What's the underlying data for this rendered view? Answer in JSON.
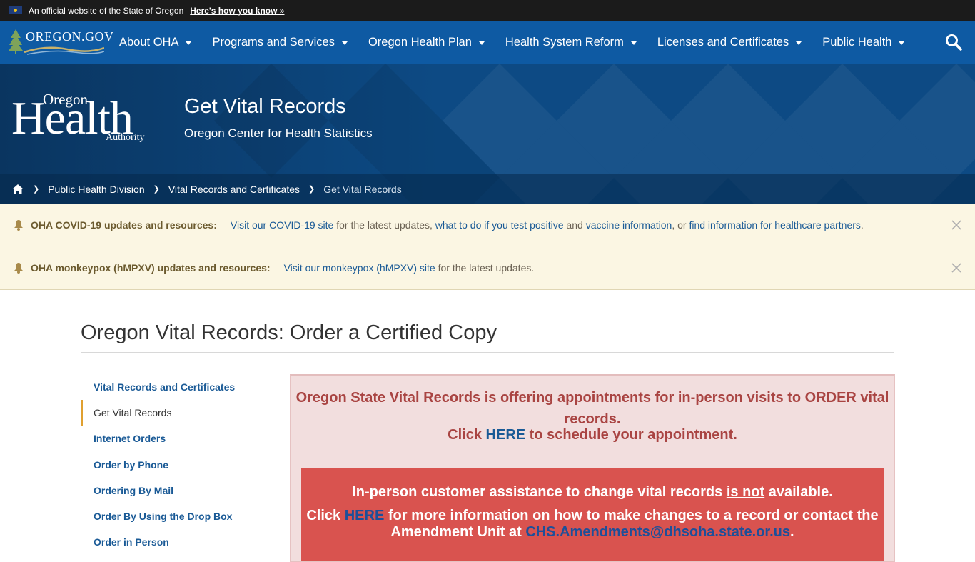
{
  "govbar": {
    "official_text": "An official website of the State of Oregon",
    "how_text": "Here's how you know »"
  },
  "nav": {
    "logo_text": "OREGON.GOV",
    "items": [
      {
        "label": "About OHA"
      },
      {
        "label": "Programs and Services"
      },
      {
        "label": "Oregon Health Plan"
      },
      {
        "label": "Health System Reform"
      },
      {
        "label": "Licenses and Certificates"
      },
      {
        "label": "Public Health"
      }
    ],
    "search_icon": "search-icon"
  },
  "hero": {
    "logo_oregon": "Oregon",
    "logo_health": "Health",
    "logo_authority": "Authority",
    "title": "Get Vital Records",
    "subtitle": "Oregon Center for Health Statistics"
  },
  "breadcrumb": {
    "items": [
      "Public Health Division",
      "Vital Records and Certificates"
    ],
    "current": "Get Vital Records"
  },
  "alerts": [
    {
      "label": "OHA COVID-19 updates and resources:",
      "parts": [
        "Visit our COVID-19 site",
        " for the latest updates, ",
        "what to do if you test positive",
        " and ",
        "vaccine information",
        ", or ",
        "find information for healthcare partners",
        "."
      ]
    },
    {
      "label": "OHA monkeypox (hMPXV) updates and resources:",
      "parts": [
        "Visit our monkeypox (hMPXV) site",
        " for the latest updates."
      ]
    }
  ],
  "main": {
    "page_title": "Oregon Vital Records: Order a Certified Copy",
    "sidenav": [
      "Vital Records and Certificates",
      "Get Vital Records",
      "Internet Orders",
      "Order by Phone",
      "Ordering By Mail",
      "Order By Using the Drop Box",
      "Order in Person"
    ],
    "notice": {
      "line1": "Oregon State Vital Records is offering appointments for in-person visits to ORDER vital records.",
      "click": "Click ",
      "here": "HERE",
      "line2_rest": " to schedule your appointment.",
      "red_line1_a": "In-person customer assistance to change vital records ",
      "red_line1_u": "is not",
      "red_line1_b": " available.",
      "red_click": "Click ",
      "red_here": "HERE",
      "red_line2_rest": " for more information on how to make changes to a record or contact the Amendment Unit at ",
      "red_email": "CHS.Amendments@dhsoha.state.or.us",
      "red_period": "."
    }
  },
  "colors": {
    "nav_blue": "#0e5aa3",
    "link_blue": "#1a5a96",
    "alert_bg": "#fbf6e3",
    "notice_bg": "#f2dede",
    "notice_text": "#a94442",
    "red_box": "#d9534f"
  }
}
